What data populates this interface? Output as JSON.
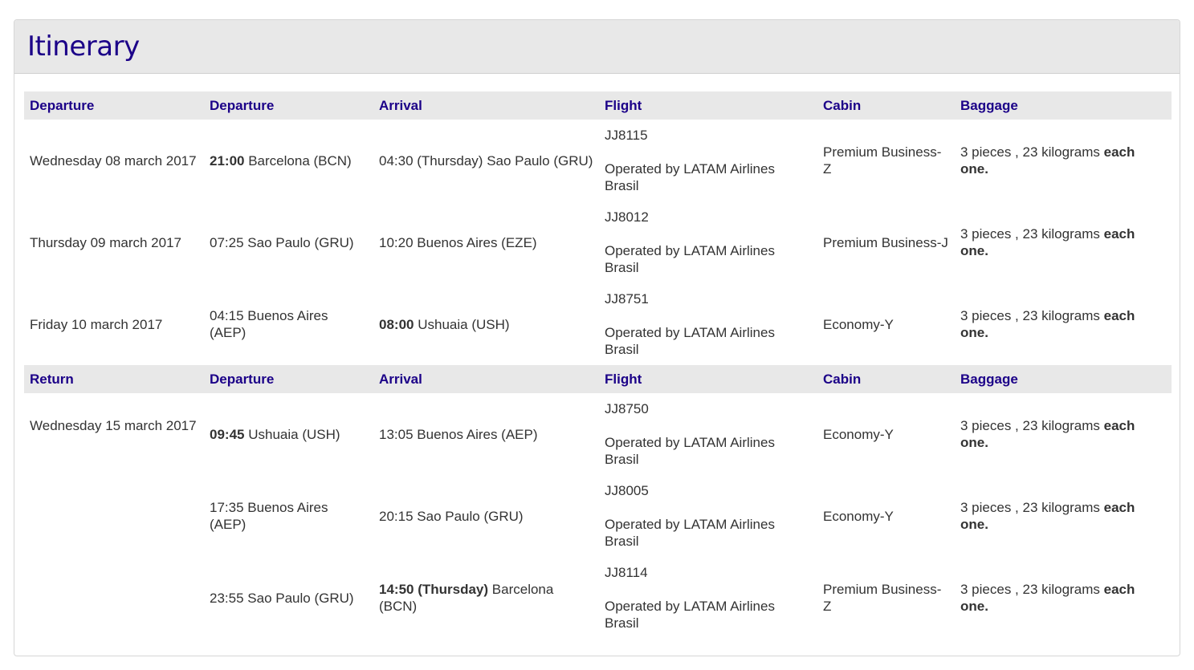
{
  "title": "Itinerary",
  "sections": [
    {
      "headers": [
        "Departure",
        "Departure",
        "Arrival",
        "Flight",
        "Cabin",
        "Baggage"
      ],
      "rows": [
        {
          "date": "Wednesday 08 march 2017",
          "dep_time": "21:00",
          "dep_place": "Barcelona (BCN)",
          "arr_time": "04:30 (Thursday)",
          "arr_place": "Sao Paulo (GRU)",
          "flight": "JJ8115",
          "operated": "Operated by LATAM Airlines Brasil",
          "cabin": "Premium Business-Z",
          "baggage": "3 pieces , 23 kilograms",
          "baggage_each": "each one."
        },
        {
          "date": "Thursday 09 march 2017",
          "dep_time": "07:25",
          "dep_place": "Sao Paulo (GRU)",
          "arr_time": "10:20",
          "arr_place": "Buenos Aires (EZE)",
          "flight": "JJ8012",
          "operated": "Operated by LATAM Airlines Brasil",
          "cabin": "Premium Business-J",
          "baggage": "3 pieces , 23 kilograms",
          "baggage_each": "each one."
        },
        {
          "date": "Friday 10 march 2017",
          "dep_time": "04:15",
          "dep_place": "Buenos Aires (AEP)",
          "arr_time": "08:00",
          "arr_place": "Ushuaia (USH)",
          "flight": "JJ8751",
          "operated": "Operated by LATAM Airlines Brasil",
          "cabin": "Economy-Y",
          "baggage": "3 pieces , 23 kilograms",
          "baggage_each": "each one."
        }
      ]
    },
    {
      "headers": [
        "Return",
        "Departure",
        "Arrival",
        "Flight",
        "Cabin",
        "Baggage"
      ],
      "rows": [
        {
          "date": "Wednesday 15 march 2017",
          "dep_time": "09:45",
          "dep_place": "Ushuaia (USH)",
          "arr_time": "13:05",
          "arr_place": "Buenos Aires (AEP)",
          "flight": "JJ8750",
          "operated": "Operated by LATAM Airlines Brasil",
          "cabin": "Economy-Y",
          "baggage": "3 pieces , 23 kilograms",
          "baggage_each": "each one."
        },
        {
          "date": "",
          "dep_time": "17:35",
          "dep_place": "Buenos Aires (AEP)",
          "arr_time": "20:15",
          "arr_place": "Sao Paulo (GRU)",
          "flight": "JJ8005",
          "operated": "Operated by LATAM Airlines Brasil",
          "cabin": "Economy-Y",
          "baggage": "3 pieces , 23 kilograms",
          "baggage_each": "each one."
        },
        {
          "date": "",
          "dep_time": "23:55",
          "dep_place": "Sao Paulo (GRU)",
          "arr_time": "14:50 (Thursday)",
          "arr_place": "Barcelona (BCN)",
          "flight": "JJ8114",
          "operated": "Operated by LATAM Airlines Brasil",
          "cabin": "Premium Business-Z",
          "baggage": "3 pieces , 23 kilograms",
          "baggage_each": "each one."
        }
      ]
    }
  ],
  "colors": {
    "accent": "#1b0088",
    "header_bg": "#e8e8e8",
    "text": "#333333"
  }
}
